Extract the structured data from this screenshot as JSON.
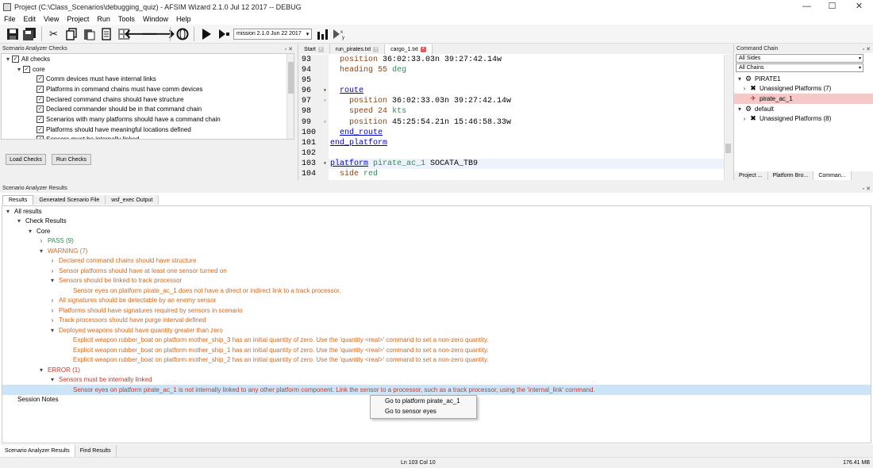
{
  "window": {
    "title": "Project (C:\\Class_Scenarios\\debugging_quiz) - AFSIM Wizard 2.1.0 Jul 12 2017 -- DEBUG",
    "minimize": "—",
    "maximize": "☐",
    "close": "✕"
  },
  "menu": [
    "File",
    "Edit",
    "View",
    "Project",
    "Run",
    "Tools",
    "Window",
    "Help"
  ],
  "toolbar": {
    "mission_select": "mission 2.1.0 Jun 22 2017"
  },
  "checks_panel": {
    "title": "Scenario Analyzer Checks",
    "controls": "▫ ✕",
    "items": [
      {
        "label": "All checks",
        "level": 0
      },
      {
        "label": "core",
        "level": 1
      },
      {
        "label": "Comm devices must have internal links",
        "level": 2
      },
      {
        "label": "Platforms in command chains must have comm devices",
        "level": 2
      },
      {
        "label": "Declared command chains should have structure",
        "level": 2
      },
      {
        "label": "Declared commander should be in that command chain",
        "level": 2
      },
      {
        "label": "Scenarios with many platforms should have a command chain",
        "level": 2
      },
      {
        "label": "Platforms should have meaningful locations defined",
        "level": 2
      },
      {
        "label": "Sensors must be internally linked",
        "level": 2
      }
    ],
    "load_button": "Load Checks",
    "run_button": "Run Checks"
  },
  "editor": {
    "tabs": [
      {
        "label": "Start",
        "active": false,
        "close_color": "#cccccc"
      },
      {
        "label": "run_pirates.txt",
        "active": false,
        "close_color": "#cccccc"
      },
      {
        "label": "cargo_1.txt",
        "active": true,
        "close_color": "#e05a5a"
      }
    ],
    "lines": [
      {
        "n": "93",
        "code": "  position 36:02:33.03n 39:27:42.14w",
        "fold": ""
      },
      {
        "n": "94",
        "code": "  heading 55 deg",
        "fold": ""
      },
      {
        "n": "95",
        "code": "",
        "fold": ""
      },
      {
        "n": "96",
        "code": "  route",
        "fold": "▾"
      },
      {
        "n": "97",
        "code": "    position 36:02:33.03n 39:27:42.14w",
        "fold": "▫"
      },
      {
        "n": "98",
        "code": "    speed 24 kts",
        "fold": ""
      },
      {
        "n": "99",
        "code": "    position 45:25:54.21n 15:46:58.33w",
        "fold": "▫"
      },
      {
        "n": "100",
        "code": "  end_route",
        "fold": ""
      },
      {
        "n": "101",
        "code": "end_platform",
        "fold": ""
      },
      {
        "n": "102",
        "code": "",
        "fold": ""
      },
      {
        "n": "103",
        "code": "platform pirate_ac_1 SOCATA_TB9",
        "fold": "▾"
      },
      {
        "n": "104",
        "code": "  side red",
        "fold": ""
      }
    ]
  },
  "command_chain": {
    "title": "Command Chain",
    "sides_select": "All Sides",
    "chains_select": "All Chains",
    "tree": [
      {
        "label": "PIRATE1",
        "level": 0,
        "icon": "gear-icon"
      },
      {
        "label": "Unassigned Platforms (7)",
        "level": 1,
        "icon": "x-icon"
      },
      {
        "label": "pirate_ac_1",
        "level": 1,
        "icon": "aircraft-icon"
      },
      {
        "label": "default",
        "level": 0,
        "icon": "gear-icon"
      },
      {
        "label": "Unassigned Platforms (8)",
        "level": 1,
        "icon": "x-icon"
      }
    ],
    "bottom_tabs": [
      "Project ...",
      "Platform Bro...",
      "Comman..."
    ]
  },
  "results": {
    "title": "Scenario Analyzer Results",
    "tabs": [
      "Results",
      "Generated Scenario File",
      "wsf_exec Output"
    ],
    "rows": [
      {
        "text": "All results",
        "level": 0,
        "arrow": "▾",
        "cls": ""
      },
      {
        "text": "Check Results",
        "level": 1,
        "arrow": "▾",
        "cls": ""
      },
      {
        "text": "Core",
        "level": 2,
        "arrow": "▾",
        "cls": ""
      },
      {
        "text": "PASS (9)",
        "level": 3,
        "arrow": "›",
        "cls": "ok"
      },
      {
        "text": "WARNING (7)",
        "level": 3,
        "arrow": "▾",
        "cls": "warn"
      },
      {
        "text": "Declared command chains should have structure",
        "level": 4,
        "arrow": "›",
        "cls": "warn"
      },
      {
        "text": "Sensor platforms should have at least one sensor turned on",
        "level": 4,
        "arrow": "›",
        "cls": "warn"
      },
      {
        "text": "Sensors should be linked to track processor",
        "level": 4,
        "arrow": "▾",
        "cls": "warn"
      },
      {
        "text": "Sensor eyes on platform pirate_ac_1 does not have a direct or indirect link to a track processor.",
        "level": 5,
        "arrow": "",
        "cls": "warn"
      },
      {
        "text": "All signatures should be detectable by an enemy sensor",
        "level": 4,
        "arrow": "›",
        "cls": "warn"
      },
      {
        "text": "Platforms should have signatures required by sensors in scenario",
        "level": 4,
        "arrow": "›",
        "cls": "warn"
      },
      {
        "text": "Track processors should have purge interval defined",
        "level": 4,
        "arrow": "›",
        "cls": "warn"
      },
      {
        "text": "Deployed weapons should have quantity greater than zero",
        "level": 4,
        "arrow": "▾",
        "cls": "warn"
      },
      {
        "text": "Explicit weapon rubber_boat on platform mother_ship_3 has an initial quantity of zero. Use the 'quantity <real>' command to set a non-zero quantity.",
        "level": 5,
        "arrow": "",
        "cls": "warn"
      },
      {
        "text": "Explicit weapon rubber_boat on platform mother_ship_1 has an initial quantity of zero. Use the 'quantity <real>' command to set a non-zero quantity.",
        "level": 5,
        "arrow": "",
        "cls": "warn"
      },
      {
        "text": "Explicit weapon rubber_boat on platform mother_ship_2 has an initial quantity of zero. Use the 'quantity <real>' command to set a non-zero quantity.",
        "level": 5,
        "arrow": "",
        "cls": "warn"
      },
      {
        "text": "ERROR (1)",
        "level": 3,
        "arrow": "▾",
        "cls": "err"
      },
      {
        "text": "Sensors must be internally linked",
        "level": 4,
        "arrow": "▾",
        "cls": "err"
      },
      {
        "text": "Sensor eyes on platform pirate_ac_1 is not internally linked to any other platform component. Link the sensor to a processor, such as a track processor, using the 'internal_link' command.",
        "level": 5,
        "arrow": "",
        "cls": "err hl"
      },
      {
        "text": "Session Notes",
        "level": 1,
        "arrow": "",
        "cls": ""
      }
    ],
    "context_menu": [
      "Go to platform pirate_ac_1",
      "Go to sensor eyes"
    ]
  },
  "bottom_tabs": [
    "Scenario Analyzer Results",
    "Find Results"
  ],
  "status": {
    "position": "Ln 103 Col 10",
    "memory": "176.41 MB"
  }
}
